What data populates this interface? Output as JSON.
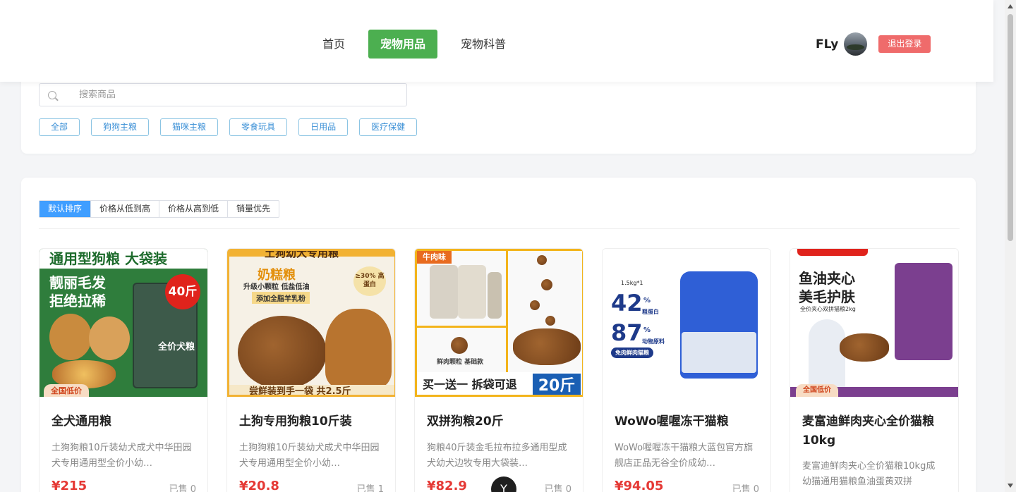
{
  "nav": {
    "items": [
      {
        "label": "首页",
        "active": false
      },
      {
        "label": "宠物用品",
        "active": true
      },
      {
        "label": "宠物科普",
        "active": false
      }
    ]
  },
  "user": {
    "name": "FLy",
    "logout_label": "退出登录"
  },
  "search": {
    "placeholder": "搜索商品",
    "icon": "search-icon"
  },
  "categories": [
    "全部",
    "狗狗主粮",
    "猫咪主粮",
    "零食玩具",
    "日用品",
    "医疗保健"
  ],
  "sorts": [
    {
      "label": "默认排序",
      "active": true
    },
    {
      "label": "价格从低到高",
      "active": false
    },
    {
      "label": "价格从高到低",
      "active": false
    },
    {
      "label": "销量优先",
      "active": false
    }
  ],
  "products": [
    {
      "title": "全犬通用粮",
      "desc": "土狗狗粮10斤装幼犬成犬中华田园犬专用通用型全价小幼…",
      "price": "¥215",
      "sold": "已售 0",
      "img_text": [
        "通用型狗粮 大袋装",
        "靓丽毛发",
        "拒绝拉稀",
        "40斤",
        "全价犬粮",
        "全国低价"
      ]
    },
    {
      "title": "土狗专用狗粮10斤装",
      "desc": "土狗狗粮10斤装幼犬成犬中华田园犬专用通用型全价小幼…",
      "price": "¥20.8",
      "sold": "已售 1",
      "img_text": [
        "土狗幼犬专用粮",
        "奶糕粮",
        "升级小颗粒 低盐低油",
        "添加全脂羊乳粉",
        "≥30% 高蛋白",
        "尝鲜装到手一袋 共2.5斤"
      ]
    },
    {
      "title": "双拼狗粮20斤",
      "desc": "狗粮40斤装金毛拉布拉多通用型成犬幼犬边牧专用大袋装…",
      "price": "¥82.9",
      "sold": "已售 0",
      "img_text": [
        "牛肉味",
        "鲜肉颗粒 基础款",
        "买一送一 拆袋可退",
        "20斤"
      ]
    },
    {
      "title": "WoWo喔喔冻干猫粮",
      "desc": "WoWo喔喔冻干猫粮大蓝包官方旗舰店正品无谷全价成幼…",
      "price": "¥94.05",
      "sold": "已售 0",
      "img_text": [
        "1.5kg*1",
        "42",
        "%",
        "粗蛋白",
        "87",
        "%",
        "动物原料",
        "免肉鲜肉猫粮"
      ]
    },
    {
      "title": "麦富迪鲜肉夹心全价猫粮10kg",
      "desc": "麦富迪鲜肉夹心全价猫粮10kg成幼猫通用猫粮鱼油蛋黄双拼",
      "price": "",
      "sold": "",
      "img_text": [
        "鱼油夹心",
        "美毛护肤",
        "全价夹心双拼猫粮2kg",
        "全国低价"
      ]
    }
  ],
  "floating_badge": "Y"
}
